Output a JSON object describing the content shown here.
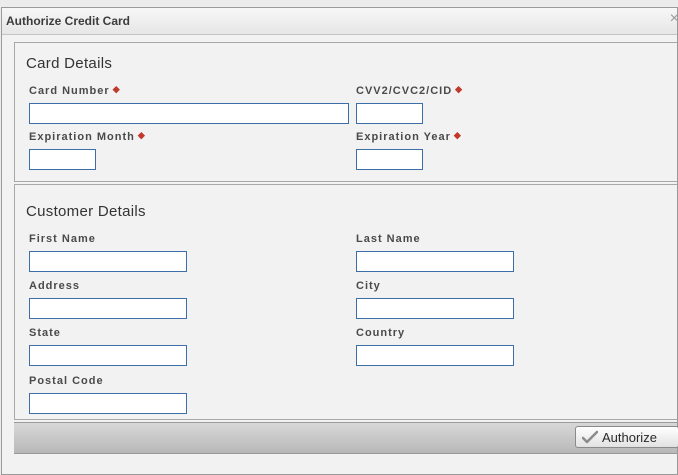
{
  "dialog": {
    "title": "Authorize Credit Card",
    "close_glyph": "×"
  },
  "card_details": {
    "heading": "Card Details",
    "required_marker": "◆",
    "card_number": {
      "label": "Card Number",
      "value": "",
      "required": true
    },
    "cvv": {
      "label": "CVV2/CVC2/CID",
      "value": "",
      "required": true
    },
    "exp_month": {
      "label": "Expiration Month",
      "value": "",
      "required": true
    },
    "exp_year": {
      "label": "Expiration Year",
      "value": "",
      "required": true
    }
  },
  "customer_details": {
    "heading": "Customer Details",
    "first_name": {
      "label": "First Name",
      "value": ""
    },
    "last_name": {
      "label": "Last Name",
      "value": ""
    },
    "address": {
      "label": "Address",
      "value": ""
    },
    "city": {
      "label": "City",
      "value": ""
    },
    "state": {
      "label": "State",
      "value": ""
    },
    "country": {
      "label": "Country",
      "value": ""
    },
    "postal_code": {
      "label": "Postal Code",
      "value": ""
    }
  },
  "footer": {
    "authorize_label": "Authorize",
    "authorize_icon": "checkmark-icon"
  },
  "colors": {
    "input_border": "#3c6fa8",
    "required": "#c0392b",
    "accent_check": "#9a9a9a"
  }
}
